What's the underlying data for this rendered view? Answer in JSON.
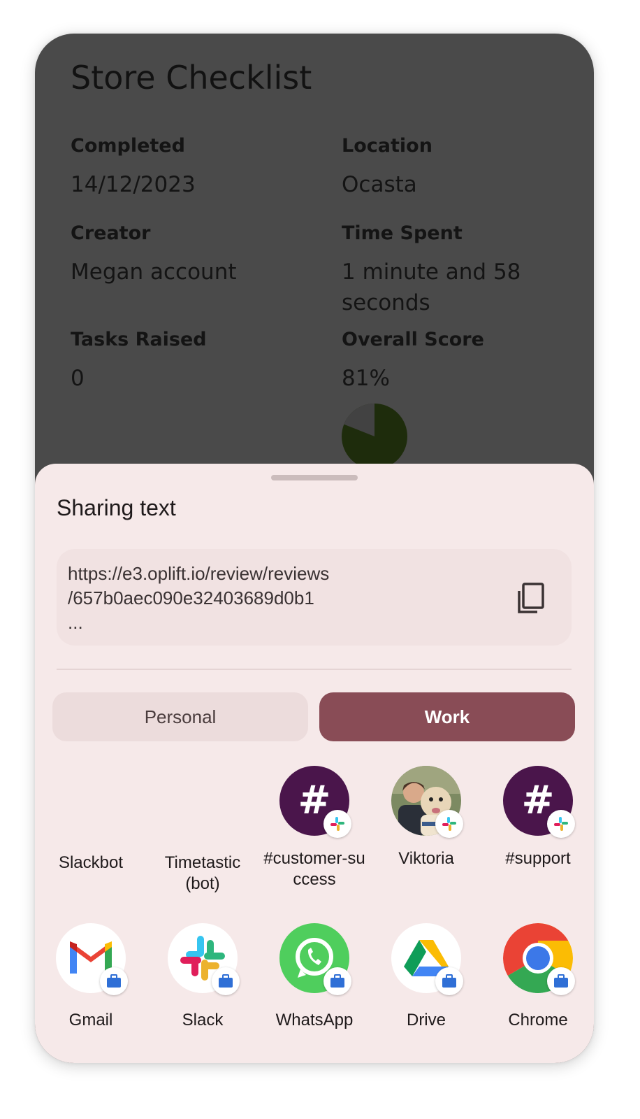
{
  "background_screen": {
    "title": "Store Checklist",
    "fields": {
      "completed": {
        "label": "Completed",
        "value": "14/12/2023"
      },
      "location": {
        "label": "Location",
        "value": "Ocasta"
      },
      "creator": {
        "label": "Creator",
        "value": "Megan account"
      },
      "time_spent": {
        "label": "Time Spent",
        "value": "1 minute and 58 seconds"
      },
      "tasks_raised": {
        "label": "Tasks Raised",
        "value": "0"
      },
      "overall_score": {
        "label": "Overall Score",
        "value": "81%"
      }
    },
    "score_fraction": 0.81
  },
  "share_sheet": {
    "title": "Sharing text",
    "shared_text": "https://e3.oplift.io/review/reviews\n/657b0aec090e32403689d0b1\n...",
    "copy_icon": "copy-icon",
    "tabs": {
      "personal": "Personal",
      "work": "Work",
      "selected": "Work"
    },
    "direct_share": [
      {
        "label": "Slackbot"
      },
      {
        "label": "Timetastic (bot)"
      },
      {
        "label": "#customer-success",
        "icon": "channel-hash-icon"
      },
      {
        "label": "Viktoria",
        "icon": "contact-avatar"
      },
      {
        "label": "#support",
        "icon": "channel-hash-icon"
      }
    ],
    "apps": [
      {
        "label": "Gmail",
        "icon": "gmail-icon"
      },
      {
        "label": "Slack",
        "icon": "slack-icon"
      },
      {
        "label": "WhatsApp",
        "icon": "whatsapp-icon"
      },
      {
        "label": "Drive",
        "icon": "drive-icon"
      },
      {
        "label": "Chrome",
        "icon": "chrome-icon"
      }
    ],
    "colors": {
      "sheet_bg": "#f6e9e9",
      "work_tab": "#894c56",
      "personal_tab": "#ecdcdc",
      "work_badge": "#2f6fd6"
    }
  }
}
